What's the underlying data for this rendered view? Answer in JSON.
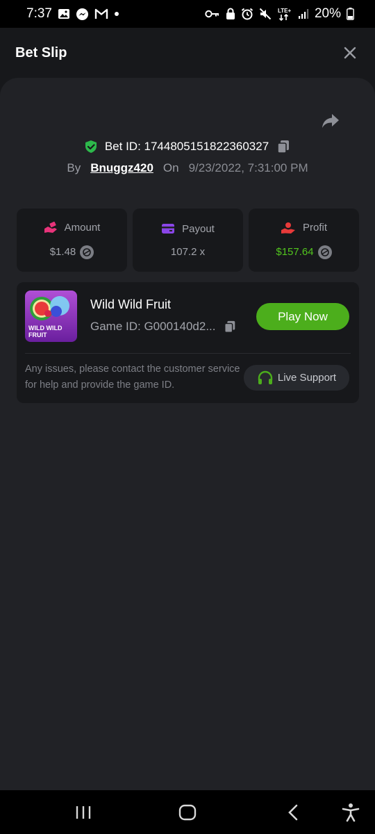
{
  "status_bar": {
    "time": "7:37",
    "battery": "20%",
    "icons_left": [
      "image-icon",
      "messenger-icon",
      "gmail-icon",
      "dot-icon"
    ],
    "icons_right": [
      "key-icon",
      "lock-icon",
      "alarm-icon",
      "mute-icon",
      "lte-icon",
      "signal-icon",
      "battery-icon"
    ],
    "lte_label": "LTE+"
  },
  "header": {
    "title": "Bet Slip"
  },
  "bet": {
    "id_label": "Bet ID: 1744805151822360327",
    "by_label": "By",
    "user": "Bnuggz420",
    "on_label": "On",
    "date": "9/23/2022, 7:31:00 PM"
  },
  "stats": [
    {
      "label": "Amount",
      "value": "$1.48",
      "icon": "bet-hand-icon",
      "color": "#e8337a"
    },
    {
      "label": "Payout",
      "value": "107.2 x",
      "icon": "wallet-card-icon",
      "color": "#8a45e8"
    },
    {
      "label": "Profit",
      "value": "$157.64",
      "icon": "profit-hand-icon",
      "color": "#e83a3a"
    }
  ],
  "game": {
    "name": "Wild Wild Fruit",
    "game_id": "Game ID: G000140d2...",
    "thumb_text_1": "WILD WILD",
    "thumb_text_2": "FRUIT",
    "play_label": "Play Now"
  },
  "help": {
    "text": "Any issues, please contact the customer service for help and provide the game ID.",
    "support_label": "Live Support"
  },
  "colors": {
    "accent_green": "#4cae1c",
    "profit_green": "#52c51e",
    "background": "#17181b",
    "sheet": "#212226"
  }
}
